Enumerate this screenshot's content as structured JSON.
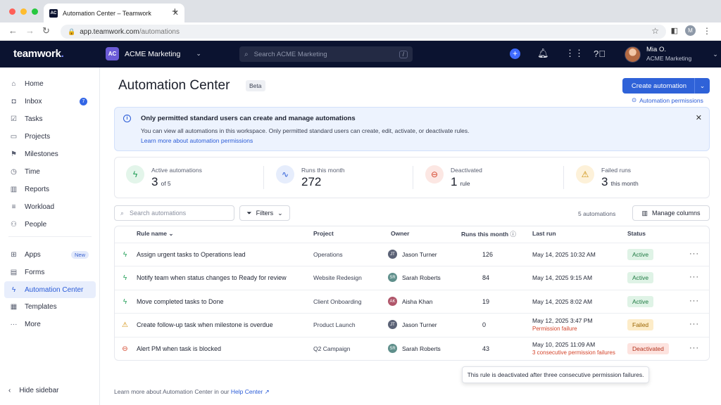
{
  "browser": {
    "tab_title": "Automation Center – Teamwork",
    "favicon_text": "AC",
    "url_host": "app.teamwork.com",
    "url_path": "/automations",
    "profile_initial": "M"
  },
  "header": {
    "logo": "teamwork",
    "logo_dot": ".",
    "workspace_badge": "AC",
    "workspace_name": "ACME Marketing",
    "search_placeholder": "Search ACME Marketing",
    "search_shortcut": "/",
    "user_name": "Mia O.",
    "user_org": "ACME Marketing"
  },
  "sidebar": {
    "items": [
      {
        "label": "Home",
        "icon": "home-icon"
      },
      {
        "label": "Inbox",
        "icon": "inbox-icon",
        "badge": "7"
      },
      {
        "label": "Tasks",
        "icon": "tasks-icon"
      },
      {
        "label": "Projects",
        "icon": "projects-icon"
      },
      {
        "label": "Milestones",
        "icon": "milestones-icon"
      },
      {
        "label": "Time",
        "icon": "clock-icon"
      },
      {
        "label": "Reports",
        "icon": "reports-icon"
      },
      {
        "label": "Workload",
        "icon": "workload-icon"
      },
      {
        "label": "People",
        "icon": "people-icon"
      }
    ],
    "items2": [
      {
        "label": "Apps",
        "icon": "apps-icon",
        "badge": "New"
      },
      {
        "label": "Forms",
        "icon": "forms-icon"
      },
      {
        "label": "Automation Center",
        "icon": "lightning-icon",
        "active": true
      },
      {
        "label": "Templates",
        "icon": "templates-icon"
      },
      {
        "label": "More",
        "icon": "more-icon"
      }
    ],
    "hide_label": "Hide sidebar"
  },
  "page": {
    "title": "Automation Center",
    "beta": "Beta",
    "create_label": "Create automation",
    "permissions_link": "Automation permissions"
  },
  "banner": {
    "title": "Only permitted standard users can create and manage automations",
    "body": "You can view all automations in this workspace. Only permitted standard users can create, edit, activate, or deactivate rules.",
    "link": "Learn more about automation permissions"
  },
  "stats": [
    {
      "label": "Active automations",
      "value": "3",
      "suffix": "of 5",
      "color": "#1f9d55"
    },
    {
      "label": "Runs this month",
      "value": "272",
      "suffix": "",
      "color": "#2a5bd7"
    },
    {
      "label": "Deactivated",
      "value": "1",
      "suffix": "rule",
      "color": "#d4442a"
    },
    {
      "label": "Failed runs",
      "value": "3",
      "suffix": "this month",
      "color": "#c98a00"
    }
  ],
  "toolbar": {
    "search_placeholder": "Search automations",
    "filters": "Filters",
    "count": "5 automations",
    "manage_columns": "Manage columns"
  },
  "table": {
    "headers": {
      "rule": "Rule name",
      "project": "Project",
      "owner": "Owner",
      "runs": "Runs this month",
      "last": "Last run",
      "status": "Status"
    },
    "rows": [
      {
        "icon": "lightning-icon",
        "name": "Assign urgent tasks to Operations lead",
        "project": "Operations",
        "owner_initials": "JT",
        "owner": "Jason Turner",
        "owner_color": "#5b6276",
        "runs": "126",
        "last": "May 14, 2025 10:32 AM",
        "last_sub": "",
        "status": "Active",
        "status_kind": "active"
      },
      {
        "icon": "lightning-icon",
        "name": "Notify team when status changes to Ready for review",
        "project": "Website Redesign",
        "owner_initials": "SR",
        "owner": "Sarah Roberts",
        "owner_color": "#5f8f8b",
        "runs": "84",
        "last": "May 14, 2025 9:15 AM",
        "last_sub": "",
        "status": "Active",
        "status_kind": "active"
      },
      {
        "icon": "lightning-icon",
        "name": "Move completed tasks to Done",
        "project": "Client Onboarding",
        "owner_initials": "AK",
        "owner": "Aisha Khan",
        "owner_color": "#b0566a",
        "runs": "19",
        "last": "May 14, 2025 8:02 AM",
        "last_sub": "",
        "status": "Active",
        "status_kind": "active"
      },
      {
        "icon": "warning-icon",
        "name": "Create follow-up task when milestone is overdue",
        "project": "Product Launch",
        "owner_initials": "JT",
        "owner": "Jason Turner",
        "owner_color": "#5b6276",
        "runs": "0",
        "last": "May 12, 2025 3:47 PM",
        "last_sub": "Permission failure",
        "status": "Failed",
        "status_kind": "failed"
      },
      {
        "icon": "blocked-icon",
        "name": "Alert PM when task is blocked",
        "project": "Q2 Campaign",
        "owner_initials": "SR",
        "owner": "Sarah Roberts",
        "owner_color": "#5f8f8b",
        "runs": "43",
        "last": "May 10, 2025 11:09 AM",
        "last_sub": "3 consecutive permission failures",
        "status": "Deactivated",
        "status_kind": "deactivated"
      }
    ]
  },
  "tooltip": "This rule is deactivated after three consecutive permission failures.",
  "footer": {
    "text": "Learn more about Automation Center in our ",
    "link": "Help Center"
  }
}
